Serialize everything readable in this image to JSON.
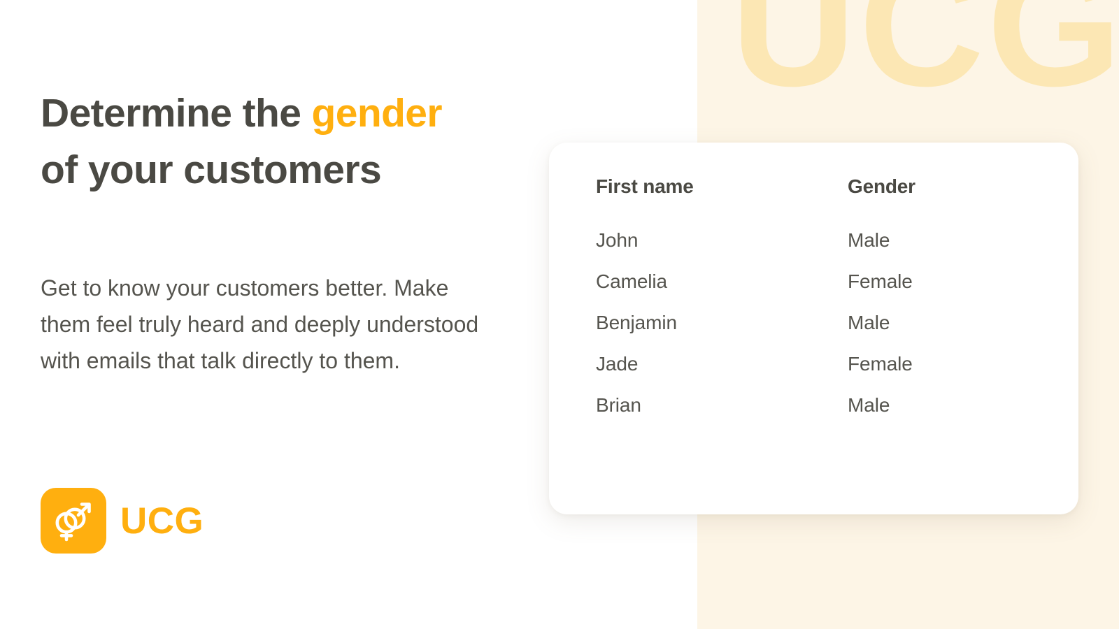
{
  "theme": {
    "accent_color": "#FFAF0F",
    "heading_color": "#4A4943",
    "body_text_color": "#55544E",
    "panel_background": "#FDF5E6",
    "watermark_color": "#FCE7B4",
    "card_background": "#FFFFFF"
  },
  "hero": {
    "headline_part1": "Determine the ",
    "headline_accent": "gender",
    "headline_part2": "of your customers",
    "body": "Get to know your customers better. Make them feel truly heard and deeply understood with emails that talk directly to them."
  },
  "brand": {
    "wordmark": "UCG",
    "watermark": "UCG",
    "icon_name": "gender-symbols-icon"
  },
  "table": {
    "columns": [
      "First name",
      "Gender"
    ],
    "rows": [
      {
        "first_name": "John",
        "gender": "Male"
      },
      {
        "first_name": "Camelia",
        "gender": "Female"
      },
      {
        "first_name": "Benjamin",
        "gender": "Male"
      },
      {
        "first_name": "Jade",
        "gender": "Female"
      },
      {
        "first_name": "Brian",
        "gender": "Male"
      }
    ]
  }
}
